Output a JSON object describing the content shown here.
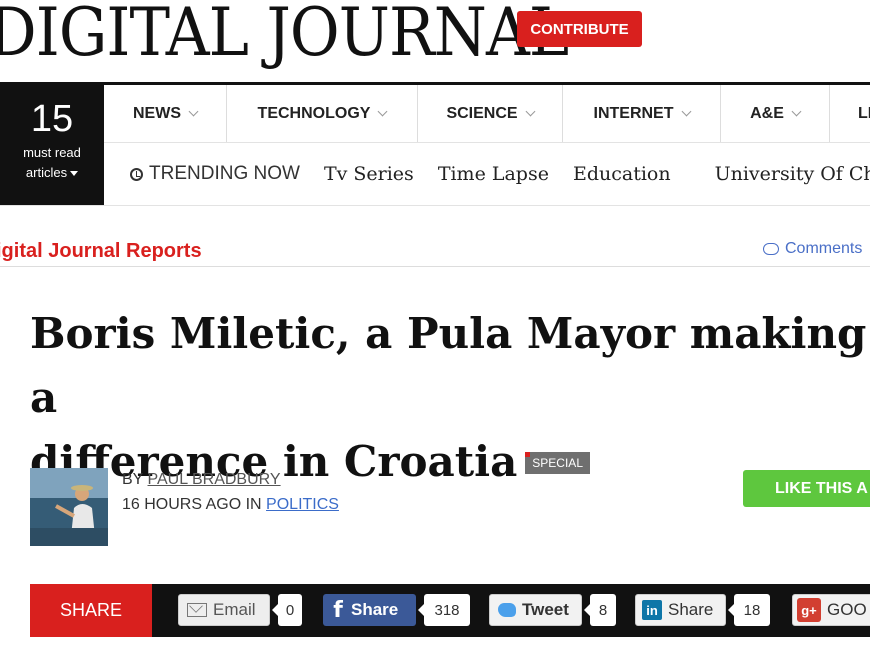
{
  "site": {
    "logo": "DIGITAL JOURNAL",
    "contribute": "CONTRIBUTE"
  },
  "must_read": {
    "count": "15",
    "label_line1": "must read",
    "label_line2": "articles"
  },
  "nav": {
    "items": [
      {
        "label": "NEWS",
        "width": 0
      },
      {
        "label": "TECHNOLOGY"
      },
      {
        "label": "SCIENCE"
      },
      {
        "label": "INTERNET"
      },
      {
        "label": "A&E"
      },
      {
        "label": "LI"
      }
    ]
  },
  "trending": {
    "label": "TRENDING NOW",
    "links": [
      "Tv Series",
      "Time Lapse",
      "Education",
      "University Of Chi"
    ]
  },
  "section": {
    "name": "igital Journal Reports",
    "comments": "Comments"
  },
  "article": {
    "title_line1": "Boris Miletic, a Pula Mayor making a",
    "title_line2": "difference in Croatia",
    "badge": "SPECIAL",
    "by_prefix": "BY",
    "author": "PAUL BRADBURY",
    "time": "16 HOURS AGO IN",
    "category": "POLITICS",
    "like_button": "LIKE THIS A"
  },
  "share": {
    "label": "SHARE",
    "email": {
      "label": "Email",
      "count": "0"
    },
    "facebook": {
      "label": "Share",
      "count": "318"
    },
    "twitter": {
      "label": "Tweet",
      "count": "8"
    },
    "linkedin": {
      "label": "Share",
      "count": "18"
    },
    "google": {
      "label": "GOO"
    }
  },
  "colors": {
    "brand_red": "#d9201e",
    "like_green": "#5ec73e",
    "facebook_blue": "#3b5998"
  }
}
